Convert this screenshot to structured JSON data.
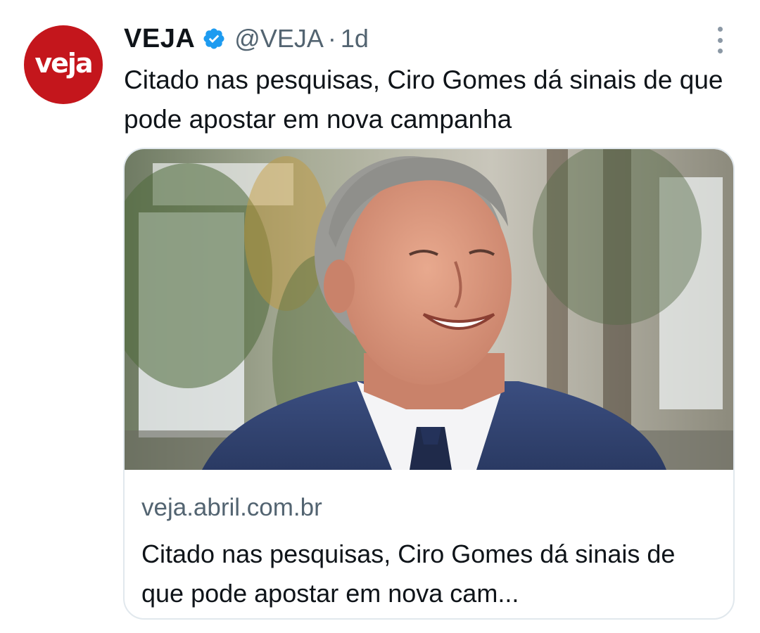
{
  "tweet": {
    "avatar_label": "veja",
    "author_name": "VEJA",
    "handle": "@VEJA",
    "separator": "·",
    "timestamp": "1d",
    "text": "Citado nas pesquisas, Ciro Gomes dá sinais de que pode apostar em nova campanha"
  },
  "card": {
    "domain": "veja.abril.com.br",
    "title": "Citado nas pesquisas, Ciro Gomes dá sinais de que pode apostar em nova cam..."
  },
  "colors": {
    "avatar_bg": "#c4161c",
    "verified": "#1d9bf0",
    "secondary_text": "#536471",
    "primary_text": "#0f1419"
  },
  "icons": {
    "verified": "verified-badge-icon",
    "more": "more-options-icon"
  }
}
